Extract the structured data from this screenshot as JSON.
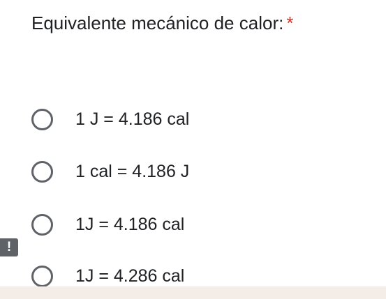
{
  "question": {
    "title": "Equivalente mecánico de calor:",
    "required_marker": "*"
  },
  "options": [
    {
      "label": "1 J = 4.186 cal",
      "selected": false
    },
    {
      "label": "1 cal = 4.186 J",
      "selected": false
    },
    {
      "label": "1J = 4.186 cal",
      "selected": false
    },
    {
      "label": "1J = 4.286 cal",
      "selected": false
    }
  ],
  "error_marker": {
    "glyph": "!"
  },
  "colors": {
    "text": "#202124",
    "required": "#d93025",
    "radio_border": "#5f6368",
    "bottom_bar": "#f4ece6"
  }
}
